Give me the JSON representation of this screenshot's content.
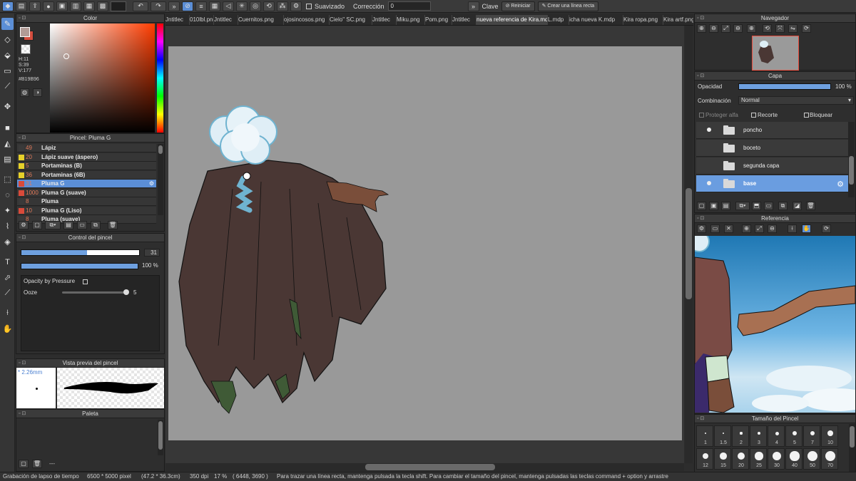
{
  "toolbar": {
    "smoothing_label": "Suavizado",
    "correction_label": "Corrección",
    "correction_value": "0",
    "key_label": "Clave",
    "reset_label": "Reiniciar",
    "straight_line_label": "Crear una línea recta"
  },
  "tabs": [
    "Jntitlec",
    "010lbl.png",
    "Jntitlec",
    "Cuernitos.png",
    "ojosincosos.png",
    "Cielo\" SC.png",
    "Jntitlec",
    "Miku.png",
    "Pom.png",
    "Jntitlec",
    "nueva referencia de Kira.mdp",
    "L.mdp",
    "icha nueva K.mdp",
    "Kira ropa.png",
    "Kira artf.png"
  ],
  "active_tab_index": 10,
  "color_panel": {
    "title": "Color",
    "h": "H:11",
    "s": "S:39",
    "v": "V:177",
    "hex": "#B19B96",
    "current_color": "#B19B96",
    "secondary_color": "#D44D3E"
  },
  "brush_panel": {
    "title": "Pincel: Pluma G",
    "brushes": [
      {
        "num": "49",
        "name": "Lápiz",
        "color": "#3a3a3a"
      },
      {
        "num": "20",
        "name": "Lápiz suave (áspero)",
        "color": "#e6d02a"
      },
      {
        "num": "5",
        "name": "Portaminas (B)",
        "color": "#e6d02a"
      },
      {
        "num": "36",
        "name": "Portaminas (6B)",
        "color": "#e6d02a"
      },
      {
        "num": "31",
        "name": "Pluma G",
        "color": "#d94a3a"
      },
      {
        "num": "1000",
        "name": "Pluma G (suave)",
        "color": "#d94a3a"
      },
      {
        "num": "8",
        "name": "Pluma",
        "color": "#3a3a3a"
      },
      {
        "num": "10",
        "name": "Pluma G (Liso)",
        "color": "#d94a3a"
      },
      {
        "num": "8",
        "name": "Pluma (suave)",
        "color": "#3a3a3a"
      }
    ],
    "selected_index": 4
  },
  "brush_control": {
    "title": "Control del pincel",
    "size_value": "31",
    "size_fraction": 0.56,
    "opacity_value": "100 %",
    "opacity_fraction": 1.0,
    "opacity_by_pressure_label": "Opacity by Pressure",
    "ooze_label": "Ooze",
    "ooze_value": "5",
    "ooze_fraction": 0.98
  },
  "brush_preview": {
    "title": "Vista previa del pincel",
    "size_label": "* 2.26mm"
  },
  "palette": {
    "title": "Paleta",
    "footer_text": "---"
  },
  "navigator": {
    "title": "Navegador"
  },
  "layers": {
    "title": "Capa",
    "opacity_label": "Opacidad",
    "opacity_value": "100 %",
    "blend_label": "Combinación",
    "blend_value": "Normal",
    "protect_alpha_label": "Proteger alfa",
    "clipping_label": "Recorte",
    "lock_label": "Bloquear",
    "items": [
      {
        "name": "poncho",
        "visible": true
      },
      {
        "name": "boceto",
        "visible": false
      },
      {
        "name": "segunda capa",
        "visible": false
      },
      {
        "name": "base",
        "visible": true
      }
    ],
    "selected_index": 3
  },
  "reference": {
    "title": "Referencia"
  },
  "brush_size": {
    "title": "Tamaño del Pincel",
    "sizes": [
      "1",
      "1.5",
      "2",
      "3",
      "4",
      "5",
      "7",
      "10",
      "12",
      "15",
      "20",
      "25",
      "30",
      "40",
      "50",
      "70"
    ]
  },
  "status": {
    "timelapse": "Grabación de lapso de tiempo",
    "canvas_size": "6500 * 5000 pixel",
    "physical_size": "(47.2 * 36.3cm)",
    "dpi": "350 dpi",
    "zoom": "17 %",
    "coords": "( 6448, 3690 )",
    "hint": "Para trazar una línea recta, mantenga pulsada la tecla shift. Para cambiar el tamaño del pincel, mantenga pulsadas las teclas command + option y arrastre"
  }
}
